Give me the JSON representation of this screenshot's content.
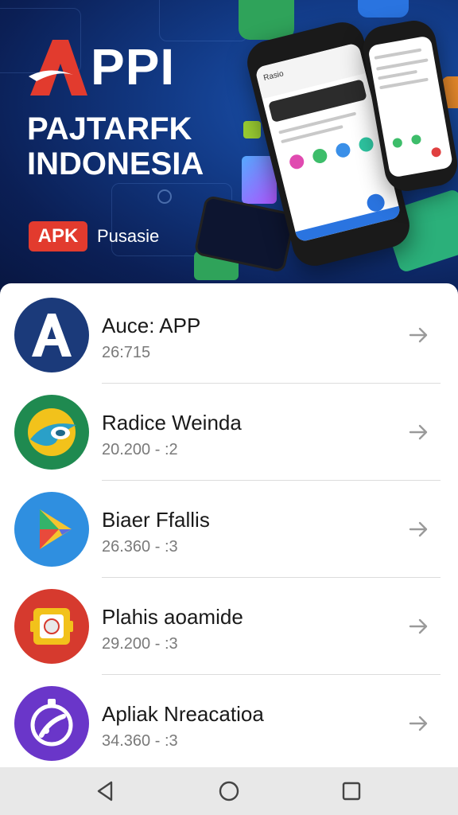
{
  "hero": {
    "logo_text": "PPI",
    "title_line1": "PAJTARFK",
    "title_line2": "INDONESIA",
    "badge": "APK",
    "subtitle": "Pusasie",
    "phone_screen_title": "Rasio"
  },
  "apps": [
    {
      "name": "Auce: APP",
      "meta": "26:715",
      "icon": "letter-a-icon",
      "color": "#1b3a7a"
    },
    {
      "name": "Radice Weinda",
      "meta": "20.200 - :2",
      "icon": "swirl-icon",
      "color": "#1f8a50"
    },
    {
      "name": "Biaer Ffallis",
      "meta": "26.360 - :3",
      "icon": "play-triangle-icon",
      "color": "#2f8fe0"
    },
    {
      "name": "Plahis aoamide",
      "meta": "29.200 - :3",
      "icon": "camera-box-icon",
      "color": "#d63a2e"
    },
    {
      "name": "Apliak Nreacatioa",
      "meta": "34.360 - :3",
      "icon": "gear-swoosh-icon",
      "color": "#6a36c9"
    }
  ],
  "nav": {
    "back_icon": "triangle-back-icon",
    "home_icon": "circle-home-icon",
    "recents_icon": "square-recents-icon"
  },
  "colors": {
    "hero_dark": "#0b1f55",
    "hero_accent": "#1d58b8",
    "badge_red": "#e23b2e",
    "list_bg": "#ffffff",
    "divider": "#dcdcdc"
  }
}
